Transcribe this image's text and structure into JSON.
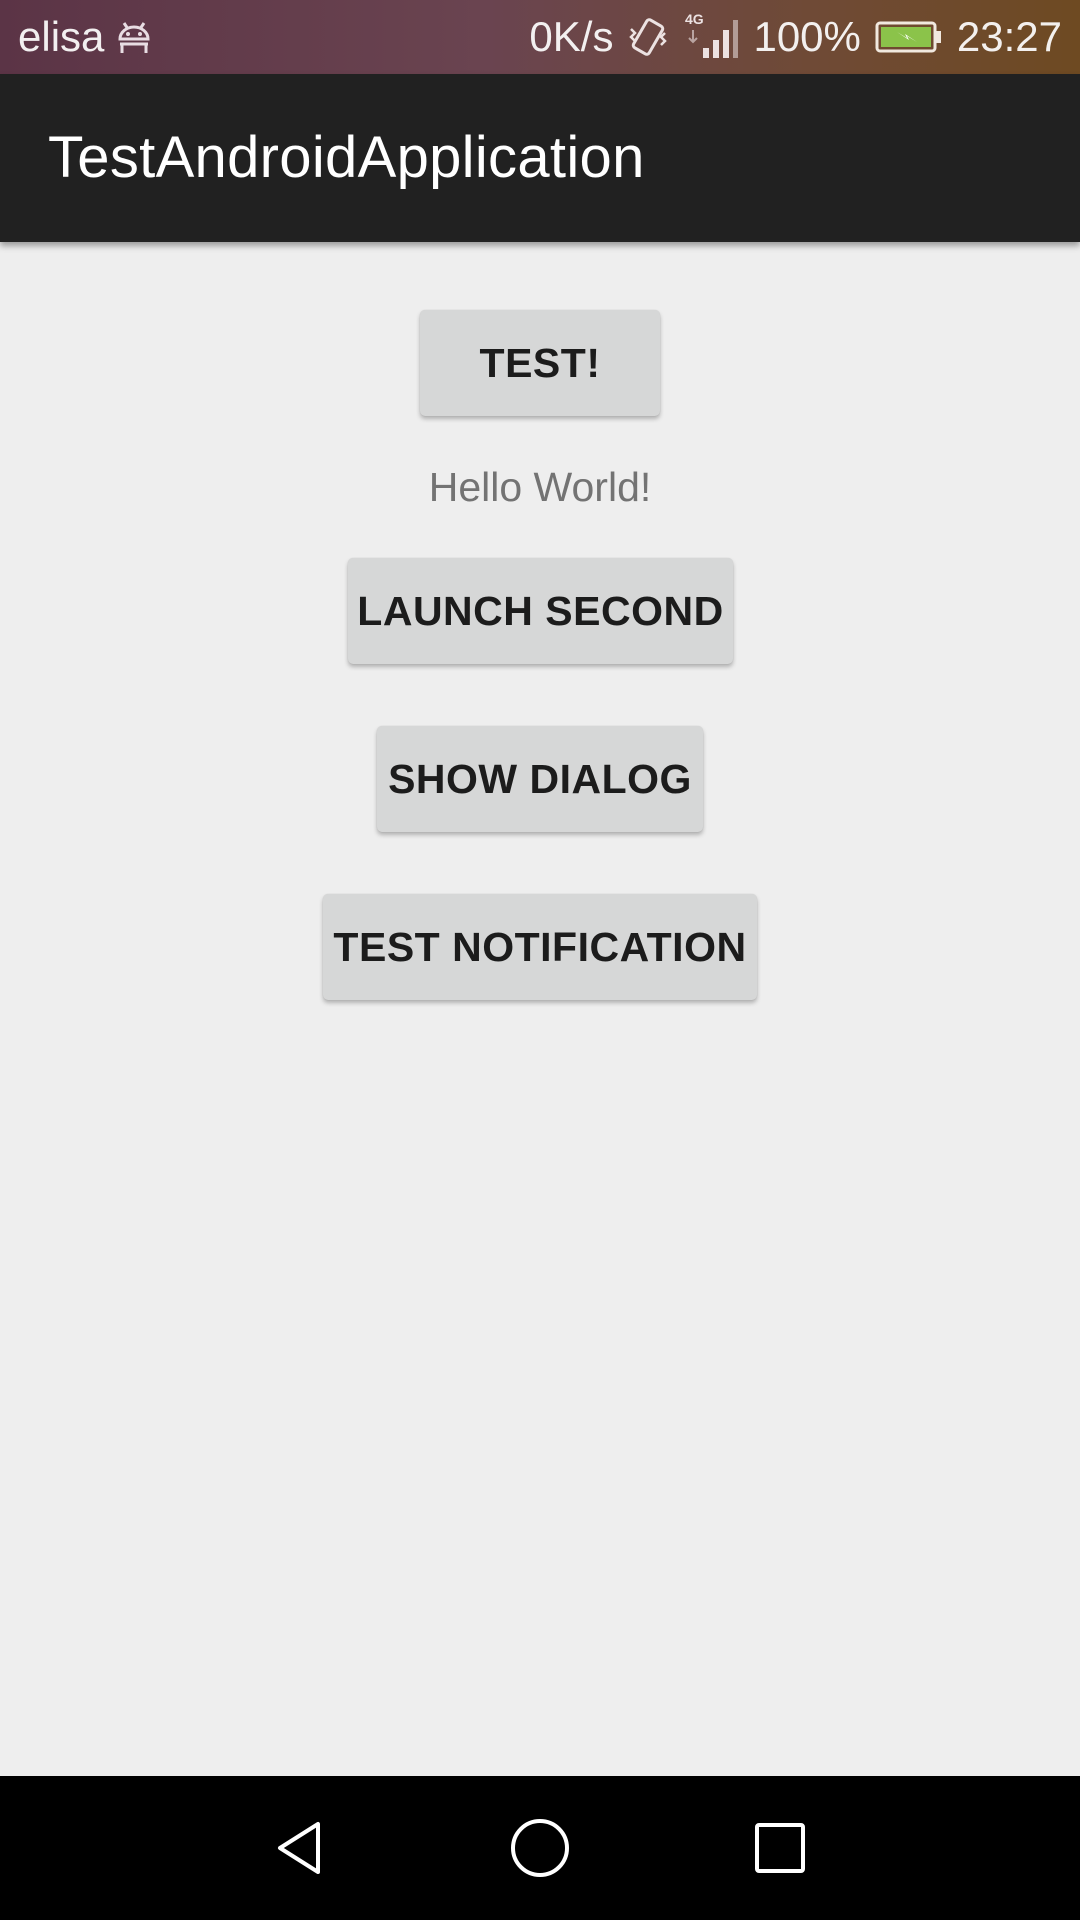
{
  "status_bar": {
    "carrier": "elisa",
    "network_speed": "0K/s",
    "network_type": "4G",
    "battery": "100%",
    "time": "23:27",
    "icons": [
      "android-debug-icon",
      "vibrate-icon",
      "signal-icon",
      "battery-charging-icon"
    ],
    "battery_color": "#8bc34a"
  },
  "app_bar": {
    "title": "TestAndroidApplication",
    "background": "#212121"
  },
  "main": {
    "test_button": "TEST!",
    "hello_text": "Hello World!",
    "launch_second_button": "LAUNCH SECOND",
    "show_dialog_button": "SHOW DIALOG",
    "test_notification_button": "TEST NOTIFICATION"
  },
  "nav_bar": {
    "icons": [
      "back-icon",
      "home-icon",
      "recents-icon"
    ]
  }
}
